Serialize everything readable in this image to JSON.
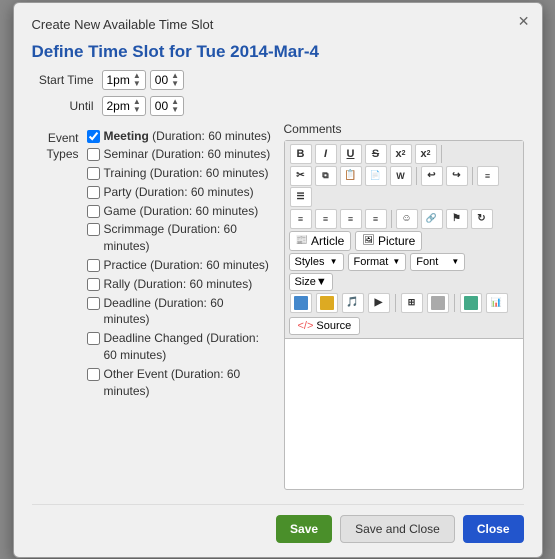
{
  "modal": {
    "title": "Create New Available Time Slot",
    "section_title": "Define Time Slot for Tue 2014-Mar-4",
    "start_time_label": "Start Time",
    "until_label": "Until",
    "start_hour": "1pm",
    "start_min": "00",
    "until_hour": "2pm",
    "until_min": "00",
    "event_types_label": "Event\nTypes"
  },
  "event_types": [
    {
      "label": "Meeting (Duration: 60 minutes)",
      "checked": true,
      "bold": true
    },
    {
      "label": "Seminar (Duration: 60 minutes)",
      "checked": false,
      "bold": false
    },
    {
      "label": "Training (Duration: 60 minutes)",
      "checked": false,
      "bold": false
    },
    {
      "label": "Party (Duration: 60 minutes)",
      "checked": false,
      "bold": false
    },
    {
      "label": "Game (Duration: 60 minutes)",
      "checked": false,
      "bold": false
    },
    {
      "label": "Scrimmage (Duration: 60 minutes)",
      "checked": false,
      "bold": false
    },
    {
      "label": "Practice (Duration: 60 minutes)",
      "checked": false,
      "bold": false
    },
    {
      "label": "Rally (Duration: 60 minutes)",
      "checked": false,
      "bold": false
    },
    {
      "label": "Deadline (Duration: 60 minutes)",
      "checked": false,
      "bold": false
    },
    {
      "label": "Deadline Changed (Duration: 60 minutes)",
      "checked": false,
      "bold": false
    },
    {
      "label": "Other Event (Duration: 60 minutes)",
      "checked": false,
      "bold": false
    }
  ],
  "comments": {
    "label": "Comments"
  },
  "toolbar": {
    "bold": "B",
    "italic": "I",
    "underline": "U",
    "strikethrough": "S",
    "subscript_label": "x",
    "superscript_label": "x",
    "article_label": "Article",
    "picture_label": "Picture",
    "styles_label": "Styles",
    "format_label": "Format",
    "font_label": "Font",
    "size_label": "Size",
    "source_label": "Source"
  },
  "footer": {
    "save_label": "Save",
    "save_close_label": "Save and Close",
    "close_label": "Close"
  }
}
